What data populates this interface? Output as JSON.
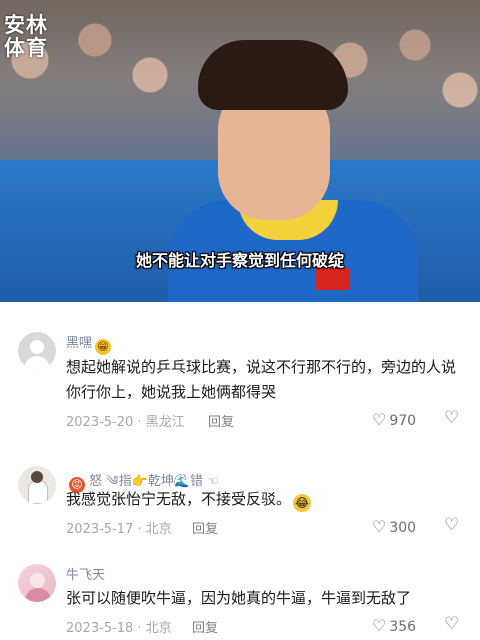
{
  "video": {
    "logo_line1": "安林",
    "logo_line2": "体育",
    "caption": "她不能让对手察觉到任何破绽"
  },
  "comments": [
    {
      "username": "黑嘿",
      "username_badge": "😁",
      "text": "想起她解说的乒乓球比赛，说这不行那不行的，旁边的人说你行你上，她说我上她俩都得哭",
      "date_location": "2023-5-20 · 黑龙江",
      "reply_label": "回复",
      "likes": "970"
    },
    {
      "username": "怒 ༄指👉乾坤🌊错 ☜",
      "username_badge": "😡",
      "text": "我感觉张怡宁无敌，不接受反驳。",
      "text_emoji": "😂",
      "date_location": "2023-5-17 · 北京",
      "reply_label": "回复",
      "likes": "300"
    },
    {
      "username": "牛飞天",
      "text": "张可以随便吹牛逼，因为她真的牛逼，牛逼到无敌了",
      "date_location": "2023-5-18 · 北京",
      "reply_label": "回复",
      "likes": "356"
    }
  ],
  "icons": {
    "like": "heart-outline-icon",
    "dislike": "broken-heart-outline-icon"
  },
  "colors": {
    "username": "#7d8a9c",
    "meta": "#a4a8b0",
    "text": "#1a1a1a"
  }
}
